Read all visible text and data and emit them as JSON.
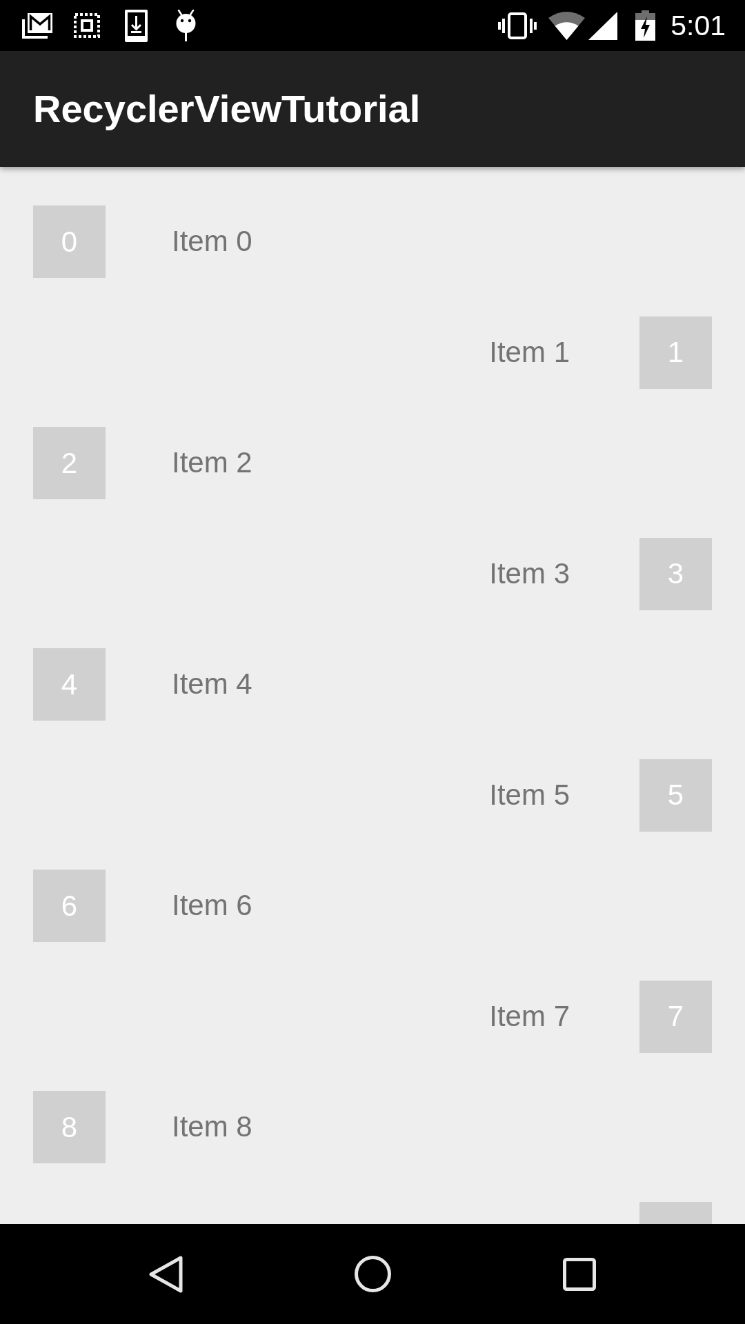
{
  "status_bar": {
    "time": "5:01"
  },
  "app_bar": {
    "title": "RecyclerViewTutorial"
  },
  "list": {
    "items": [
      {
        "kind": "left",
        "number": "0",
        "label": "Item 0"
      },
      {
        "kind": "right",
        "number": "1",
        "label": "Item 1"
      },
      {
        "kind": "left",
        "number": "2",
        "label": "Item 2"
      },
      {
        "kind": "right",
        "number": "3",
        "label": "Item 3"
      },
      {
        "kind": "left",
        "number": "4",
        "label": "Item 4"
      },
      {
        "kind": "right",
        "number": "5",
        "label": "Item 5"
      },
      {
        "kind": "left",
        "number": "6",
        "label": "Item 6"
      },
      {
        "kind": "right",
        "number": "7",
        "label": "Item 7"
      },
      {
        "kind": "left",
        "number": "8",
        "label": "Item 8"
      },
      {
        "kind": "right"
      }
    ]
  }
}
